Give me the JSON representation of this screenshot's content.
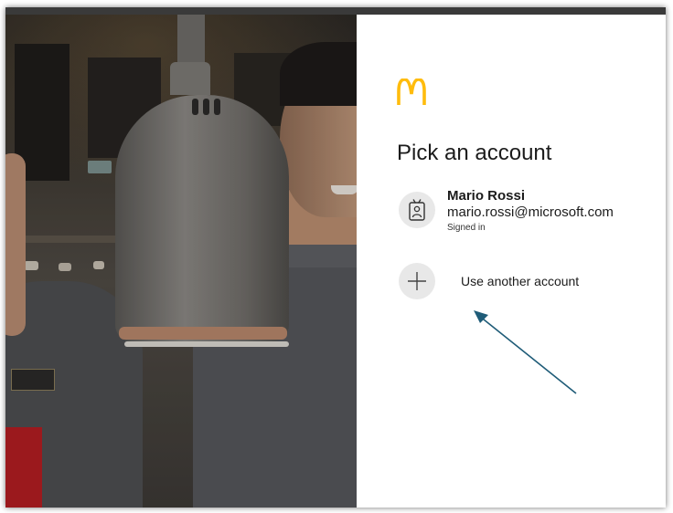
{
  "page": {
    "title": "Pick an account",
    "logo_icon": "mcdonalds-arches-icon",
    "brand_color": "#FFBC0D"
  },
  "account": {
    "name": "Mario Rossi",
    "email": "mario.rossi@microsoft.com",
    "status": "Signed in",
    "avatar_icon": "id-badge-icon"
  },
  "other_account": {
    "label": "Use another account",
    "icon": "plus-icon"
  },
  "annotation": {
    "arrow_color": "#1F5C78",
    "arrow_icon": "arrow-annotation-icon"
  }
}
